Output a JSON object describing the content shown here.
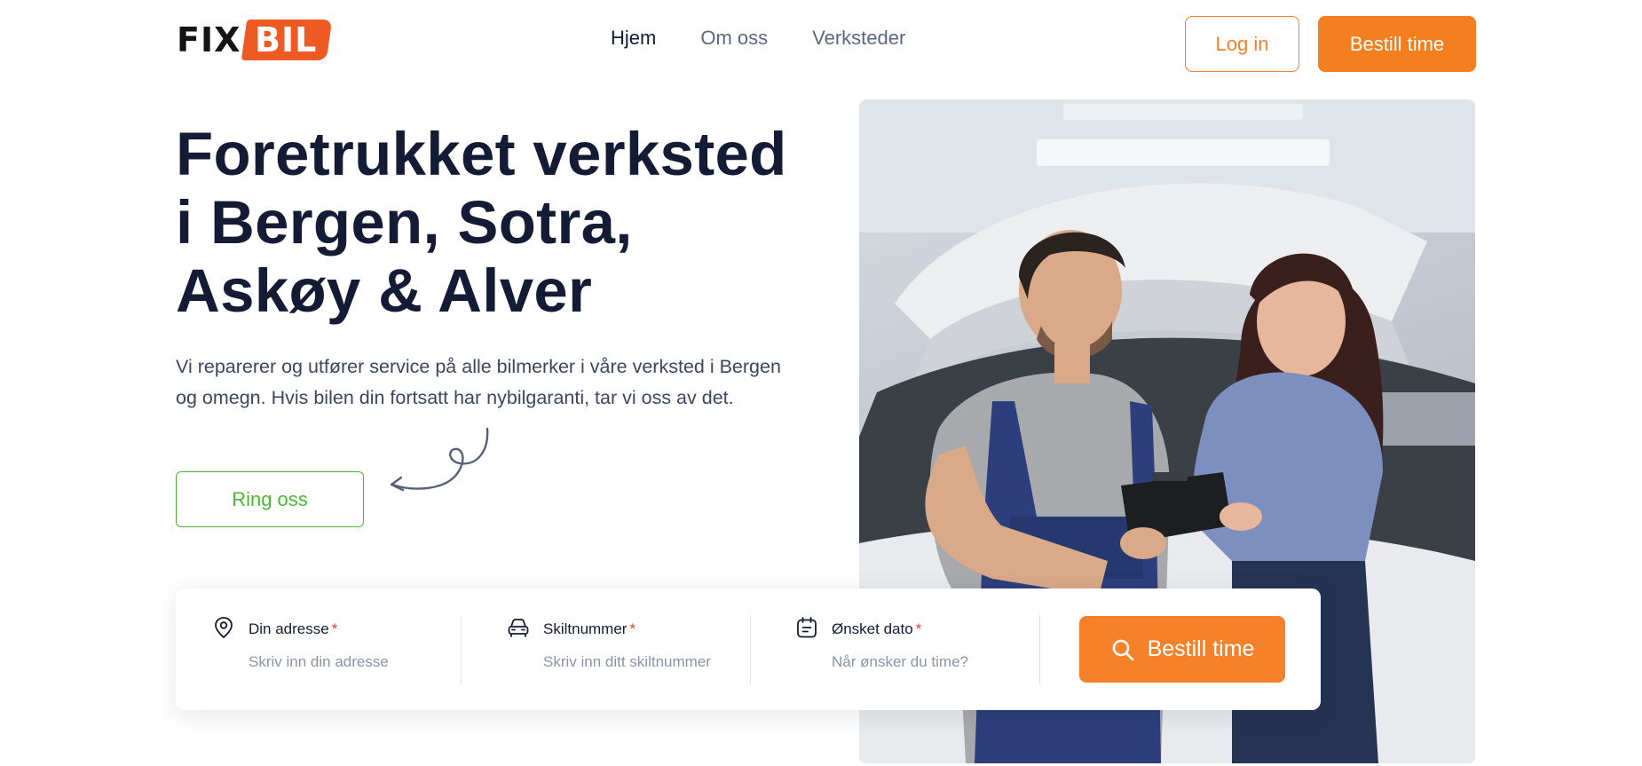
{
  "header": {
    "logo_fix": "FIX",
    "logo_bil": "BIL",
    "nav": [
      {
        "label": "Hjem",
        "active": true
      },
      {
        "label": "Om oss",
        "active": false
      },
      {
        "label": "Verksteder",
        "active": false
      }
    ],
    "login_label": "Log in",
    "book_label": "Bestill time"
  },
  "hero": {
    "title_line1": "Foretrukket verksted",
    "title_line2": "i Bergen, Sotra,",
    "title_line3": "Askøy & Alver",
    "description": "Vi reparerer og utfører service på alle bilmerker i våre verksted i Bergen og omegn. Hvis bilen din fortsatt har nybilgaranti, tar vi oss av det.",
    "call_label": "Ring oss"
  },
  "booking": {
    "address": {
      "label": "Din adresse",
      "required": "*",
      "placeholder": "Skriv inn din adresse",
      "icon": "location-pin-icon"
    },
    "plate": {
      "label": "Skiltnummer",
      "required": "*",
      "placeholder": "Skriv inn ditt skiltnummer",
      "icon": "car-icon"
    },
    "date": {
      "label": "Ønsket dato",
      "required": "*",
      "placeholder": "Når ønsker du time?",
      "icon": "calendar-icon"
    },
    "submit_label": "Bestill time",
    "submit_icon": "search-icon"
  },
  "colors": {
    "brand_orange": "#f47f1f",
    "logo_orange": "#ef5a22",
    "call_green": "#49b834",
    "heading": "#141b34",
    "required_red": "#e5392f"
  }
}
